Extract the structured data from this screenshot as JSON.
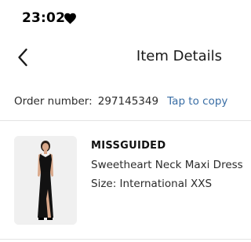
{
  "status_bar": {
    "time": "23:02",
    "icon": "heart-icon"
  },
  "header": {
    "title": "Item Details",
    "back_icon": "chevron-left-icon"
  },
  "order": {
    "label": "Order number:",
    "number": "297145349",
    "copy_label": "Tap to copy",
    "link_color": "#3a6ea5"
  },
  "item": {
    "brand": "MISSGUIDED",
    "name": "Sweetheart Neck Maxi Dress",
    "size": "Size: International XXS",
    "image": "black-maxi-dress-photo"
  }
}
